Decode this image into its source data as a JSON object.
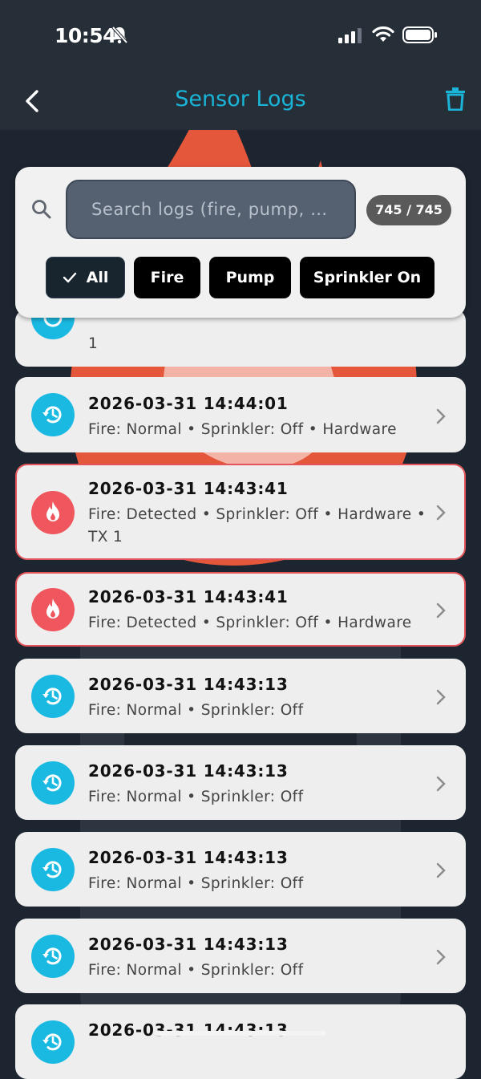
{
  "status_bar": {
    "time": "10:54"
  },
  "header": {
    "title": "Sensor Logs"
  },
  "search": {
    "placeholder": "Search logs (fire, pump, t...",
    "count": "745 / 745"
  },
  "filters": {
    "all": "All",
    "fire": "Fire",
    "pump": "Pump",
    "sprinkler_on": "Sprinkler On"
  },
  "logs": [
    {
      "timestamp": "",
      "detail": "1",
      "type": "normal"
    },
    {
      "timestamp": "2026-03-31 14:44:01",
      "detail": "Fire: Normal • Sprinkler: Off • Hardware",
      "type": "normal"
    },
    {
      "timestamp": "2026-03-31 14:43:41",
      "detail_line1": "Fire: Detected • Sprinkler: Off • Hardware •",
      "detail_line2": "TX 1",
      "type": "fire"
    },
    {
      "timestamp": "2026-03-31 14:43:41",
      "detail": "Fire: Detected • Sprinkler: Off • Hardware",
      "type": "fire"
    },
    {
      "timestamp": "2026-03-31 14:43:13",
      "detail": "Fire: Normal • Sprinkler: Off",
      "type": "normal"
    },
    {
      "timestamp": "2026-03-31 14:43:13",
      "detail": "Fire: Normal • Sprinkler: Off",
      "type": "normal"
    },
    {
      "timestamp": "2026-03-31 14:43:13",
      "detail": "Fire: Normal • Sprinkler: Off",
      "type": "normal"
    },
    {
      "timestamp": "2026-03-31 14:43:13",
      "detail": "Fire: Normal • Sprinkler: Off",
      "type": "normal"
    },
    {
      "timestamp": "2026-03-31 14:43:13",
      "detail": "",
      "type": "normal"
    }
  ],
  "colors": {
    "accent": "#19b4d6",
    "fire": "#f0565e",
    "normal": "#1ab9e2",
    "background": "#1d2530"
  },
  "icons": {
    "normal": "history-icon",
    "fire": "flame-icon"
  }
}
